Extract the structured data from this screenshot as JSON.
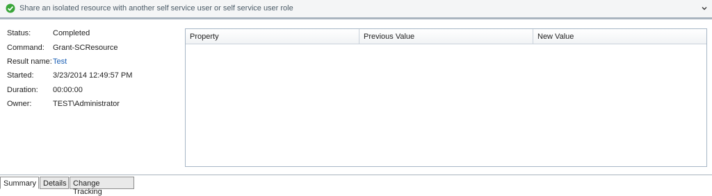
{
  "header": {
    "title": "Share an isolated resource with another self service user or self service user role",
    "status_icon": "checkmark-circle-icon",
    "expand_icon": "chevron-down-icon",
    "status_color": "#3aa63a"
  },
  "properties": {
    "status_label": "Status:",
    "status_value": "Completed",
    "command_label": "Command:",
    "command_value": "Grant-SCResource",
    "result_name_label": "Result name:",
    "result_name_value": "Test",
    "started_label": "Started:",
    "started_value": "3/23/2014 12:49:57 PM",
    "duration_label": "Duration:",
    "duration_value": "00:00:00",
    "owner_label": "Owner:",
    "owner_value": "TEST\\Administrator"
  },
  "grid": {
    "columns": [
      "Property",
      "Previous Value",
      "New Value"
    ],
    "rows": []
  },
  "tabs": [
    {
      "label": "Summary",
      "active": true
    },
    {
      "label": "Details",
      "active": false
    },
    {
      "label": "Change Tracking",
      "active": false
    }
  ]
}
